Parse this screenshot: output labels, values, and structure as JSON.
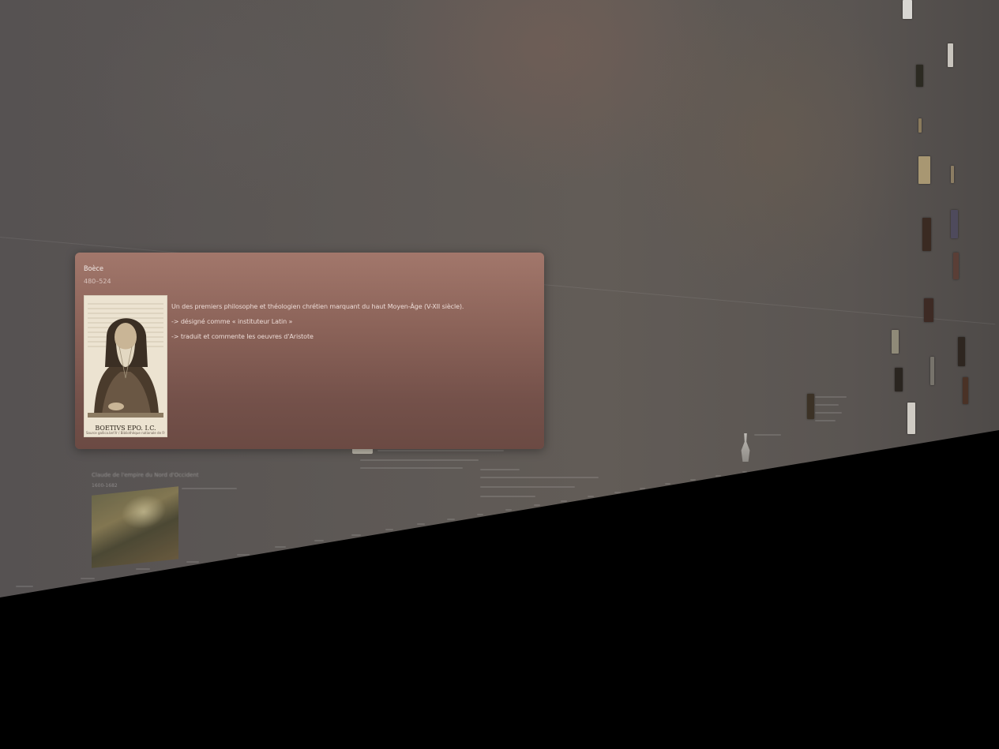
{
  "background": {
    "ghost_event_title": "Claude de l'empire du Nord d'Occident",
    "ghost_event_dates": "1600-1682"
  },
  "card": {
    "name": "Boèce",
    "dates": "480–524",
    "portrait_caption": "Source gallica.bnf.fr / Bibliothèque nationale de France",
    "portrait_inscription": "BOETIVS EPO. I.C.",
    "lines": [
      "Un des premiers philosophe et théologien chrétien marquant du haut Moyen-Âge (V-XII siècle).",
      "-> désigné comme « instituteur Latin »",
      "-> traduit et commente les oeuvres d'Aristote"
    ]
  },
  "colors": {
    "card_top": "#a2776b",
    "card_bottom": "#6b4a43",
    "outside": "#000000"
  },
  "icons": [
    "portrait-image"
  ]
}
